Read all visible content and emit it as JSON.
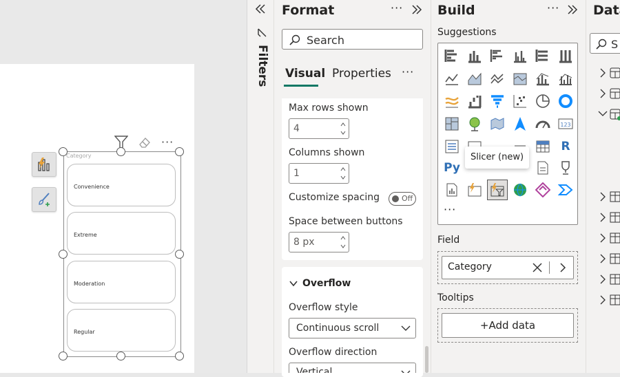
{
  "canvas": {
    "slicer": {
      "title": "Category",
      "items": [
        "Convenience",
        "Extreme",
        "Moderation",
        "Regular"
      ]
    },
    "side_buttons": [
      "slicer-visual-icon",
      "format-brush-icon"
    ],
    "header_icons": [
      "filter-icon",
      "eraser-icon",
      "more-options-icon"
    ]
  },
  "filters": {
    "label": "Filters"
  },
  "format": {
    "title": "Format",
    "search_placeholder": "Search",
    "tabs": [
      "Visual",
      "Properties"
    ],
    "active_tab": "Visual",
    "max_rows_label": "Max rows shown",
    "max_rows_value": "4",
    "columns_label": "Columns shown",
    "columns_value": "1",
    "spacing_label": "Customize spacing",
    "spacing_toggle": "Off",
    "space_between_label": "Space between buttons",
    "space_between_value": "8 px",
    "overflow_section": "Overflow",
    "overflow_style_label": "Overflow style",
    "overflow_style_value": "Continuous scroll",
    "overflow_direction_label": "Overflow direction",
    "overflow_direction_value": "Vertical"
  },
  "build": {
    "title": "Build",
    "suggestions_label": "Suggestions",
    "tooltip": "Slicer (new)",
    "field_label": "Field",
    "field_value": "Category",
    "tooltips_label": "Tooltips",
    "add_data": "+Add data"
  },
  "data": {
    "title": "Data",
    "search_placeholder": "S"
  },
  "colors": {
    "accent": "#118dff",
    "tab_underline": "#117865",
    "slicer_blue": "#4f7fbf",
    "orange": "#e8a33a"
  }
}
